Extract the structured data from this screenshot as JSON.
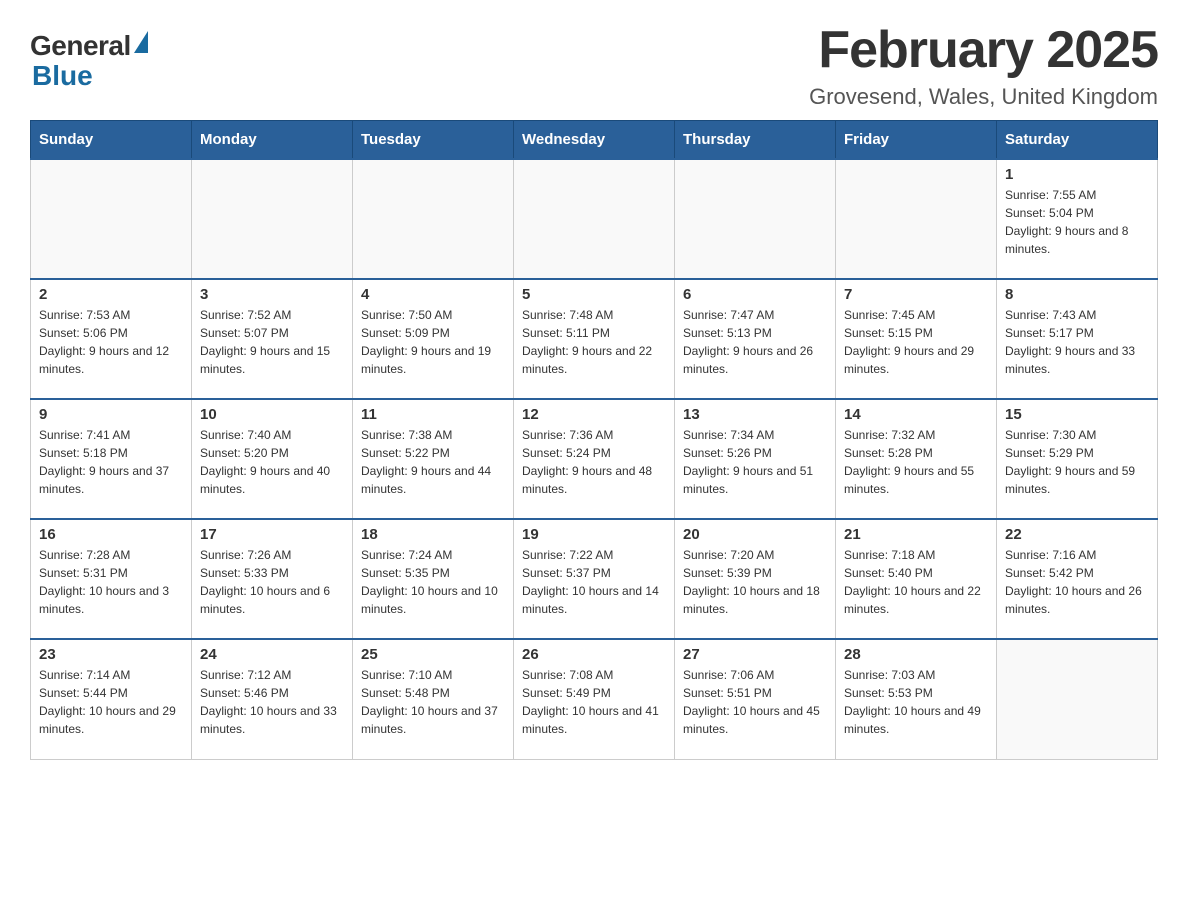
{
  "logo": {
    "general_text": "General",
    "blue_text": "Blue"
  },
  "title": "February 2025",
  "subtitle": "Grovesend, Wales, United Kingdom",
  "days_of_week": [
    "Sunday",
    "Monday",
    "Tuesday",
    "Wednesday",
    "Thursday",
    "Friday",
    "Saturday"
  ],
  "weeks": [
    [
      {
        "day": "",
        "info": ""
      },
      {
        "day": "",
        "info": ""
      },
      {
        "day": "",
        "info": ""
      },
      {
        "day": "",
        "info": ""
      },
      {
        "day": "",
        "info": ""
      },
      {
        "day": "",
        "info": ""
      },
      {
        "day": "1",
        "info": "Sunrise: 7:55 AM\nSunset: 5:04 PM\nDaylight: 9 hours and 8 minutes."
      }
    ],
    [
      {
        "day": "2",
        "info": "Sunrise: 7:53 AM\nSunset: 5:06 PM\nDaylight: 9 hours and 12 minutes."
      },
      {
        "day": "3",
        "info": "Sunrise: 7:52 AM\nSunset: 5:07 PM\nDaylight: 9 hours and 15 minutes."
      },
      {
        "day": "4",
        "info": "Sunrise: 7:50 AM\nSunset: 5:09 PM\nDaylight: 9 hours and 19 minutes."
      },
      {
        "day": "5",
        "info": "Sunrise: 7:48 AM\nSunset: 5:11 PM\nDaylight: 9 hours and 22 minutes."
      },
      {
        "day": "6",
        "info": "Sunrise: 7:47 AM\nSunset: 5:13 PM\nDaylight: 9 hours and 26 minutes."
      },
      {
        "day": "7",
        "info": "Sunrise: 7:45 AM\nSunset: 5:15 PM\nDaylight: 9 hours and 29 minutes."
      },
      {
        "day": "8",
        "info": "Sunrise: 7:43 AM\nSunset: 5:17 PM\nDaylight: 9 hours and 33 minutes."
      }
    ],
    [
      {
        "day": "9",
        "info": "Sunrise: 7:41 AM\nSunset: 5:18 PM\nDaylight: 9 hours and 37 minutes."
      },
      {
        "day": "10",
        "info": "Sunrise: 7:40 AM\nSunset: 5:20 PM\nDaylight: 9 hours and 40 minutes."
      },
      {
        "day": "11",
        "info": "Sunrise: 7:38 AM\nSunset: 5:22 PM\nDaylight: 9 hours and 44 minutes."
      },
      {
        "day": "12",
        "info": "Sunrise: 7:36 AM\nSunset: 5:24 PM\nDaylight: 9 hours and 48 minutes."
      },
      {
        "day": "13",
        "info": "Sunrise: 7:34 AM\nSunset: 5:26 PM\nDaylight: 9 hours and 51 minutes."
      },
      {
        "day": "14",
        "info": "Sunrise: 7:32 AM\nSunset: 5:28 PM\nDaylight: 9 hours and 55 minutes."
      },
      {
        "day": "15",
        "info": "Sunrise: 7:30 AM\nSunset: 5:29 PM\nDaylight: 9 hours and 59 minutes."
      }
    ],
    [
      {
        "day": "16",
        "info": "Sunrise: 7:28 AM\nSunset: 5:31 PM\nDaylight: 10 hours and 3 minutes."
      },
      {
        "day": "17",
        "info": "Sunrise: 7:26 AM\nSunset: 5:33 PM\nDaylight: 10 hours and 6 minutes."
      },
      {
        "day": "18",
        "info": "Sunrise: 7:24 AM\nSunset: 5:35 PM\nDaylight: 10 hours and 10 minutes."
      },
      {
        "day": "19",
        "info": "Sunrise: 7:22 AM\nSunset: 5:37 PM\nDaylight: 10 hours and 14 minutes."
      },
      {
        "day": "20",
        "info": "Sunrise: 7:20 AM\nSunset: 5:39 PM\nDaylight: 10 hours and 18 minutes."
      },
      {
        "day": "21",
        "info": "Sunrise: 7:18 AM\nSunset: 5:40 PM\nDaylight: 10 hours and 22 minutes."
      },
      {
        "day": "22",
        "info": "Sunrise: 7:16 AM\nSunset: 5:42 PM\nDaylight: 10 hours and 26 minutes."
      }
    ],
    [
      {
        "day": "23",
        "info": "Sunrise: 7:14 AM\nSunset: 5:44 PM\nDaylight: 10 hours and 29 minutes."
      },
      {
        "day": "24",
        "info": "Sunrise: 7:12 AM\nSunset: 5:46 PM\nDaylight: 10 hours and 33 minutes."
      },
      {
        "day": "25",
        "info": "Sunrise: 7:10 AM\nSunset: 5:48 PM\nDaylight: 10 hours and 37 minutes."
      },
      {
        "day": "26",
        "info": "Sunrise: 7:08 AM\nSunset: 5:49 PM\nDaylight: 10 hours and 41 minutes."
      },
      {
        "day": "27",
        "info": "Sunrise: 7:06 AM\nSunset: 5:51 PM\nDaylight: 10 hours and 45 minutes."
      },
      {
        "day": "28",
        "info": "Sunrise: 7:03 AM\nSunset: 5:53 PM\nDaylight: 10 hours and 49 minutes."
      },
      {
        "day": "",
        "info": ""
      }
    ]
  ]
}
